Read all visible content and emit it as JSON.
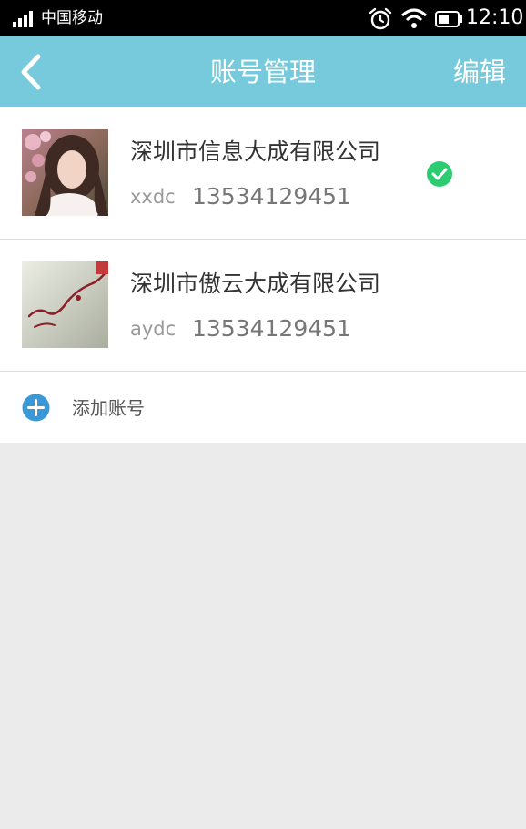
{
  "status_bar": {
    "carrier": "中国移动",
    "time": "12:10",
    "icons": [
      "signal-icon",
      "alarm-icon",
      "wifi-icon",
      "battery-icon"
    ]
  },
  "title_bar": {
    "back_icon": "chevron-left-icon",
    "title": "账号管理",
    "edit_label": "编辑",
    "background_color": "#76cadb"
  },
  "accounts": [
    {
      "company": "深圳市信息大成有限公司",
      "username": "xxdc",
      "phone": "13534129451",
      "selected": true
    },
    {
      "company": "深圳市傲云大成有限公司",
      "username": "aydc",
      "phone": "13534129451",
      "selected": false
    }
  ],
  "add_account": {
    "icon": "plus-circle-icon",
    "label": "添加账号"
  },
  "colors": {
    "check": "#2ecc71",
    "add_icon": "#3a98d8"
  }
}
